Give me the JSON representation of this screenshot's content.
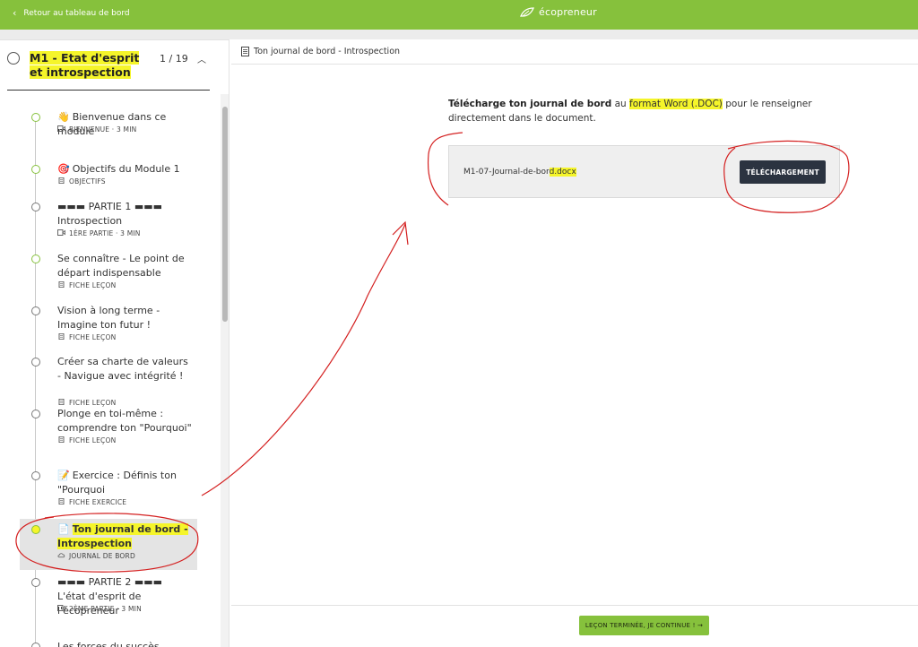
{
  "header": {
    "back_label": "Retour au tableau de bord",
    "logo_text": "écopreneur",
    "brand_color": "#86c13c"
  },
  "module": {
    "title": "M1 - Etat d'esprit et introspection",
    "progress": "1 / 19"
  },
  "lessons": [
    {
      "emoji": "👋",
      "title": "Bienvenue dans ce module",
      "meta": "BIENVENUE · 3 MIN",
      "meta_icon": "video-icon",
      "status": "done"
    },
    {
      "emoji": "🎯",
      "title": "Objectifs du Module 1",
      "meta": "OBJECTIFS",
      "meta_icon": "document-icon",
      "status": "done"
    },
    {
      "emoji": "",
      "title": "▬▬▬ PARTIE 1 ▬▬▬ Introspection",
      "meta": "1ÈRE PARTIE · 3 MIN",
      "meta_icon": "video-icon",
      "status": "todo"
    },
    {
      "emoji": "",
      "title": "Se connaître - Le point de départ indispensable",
      "meta": "FICHE LEÇON",
      "meta_icon": "document-icon",
      "status": "done"
    },
    {
      "emoji": "",
      "title": "Vision à long terme - Imagine ton futur !",
      "meta": "FICHE LEÇON",
      "meta_icon": "document-icon",
      "status": "todo"
    },
    {
      "emoji": "",
      "title": "Créer sa charte de valeurs - Navigue avec intégrité !",
      "meta": "FICHE LEÇON",
      "meta_icon": "document-icon",
      "status": "todo"
    },
    {
      "emoji": "",
      "title": "Plonge en toi-même : comprendre ton \"Pourquoi\"",
      "meta": "FICHE LEÇON",
      "meta_icon": "document-icon",
      "status": "todo"
    },
    {
      "emoji": "📝",
      "title": "Exercice : Définis ton \"Pourquoi",
      "meta": "FICHE EXERCICE",
      "meta_icon": "document-icon",
      "status": "todo"
    },
    {
      "emoji": "📄",
      "title": "Ton journal de bord - Introspection",
      "meta": "JOURNAL DE BORD",
      "meta_icon": "cloud-icon",
      "status": "active"
    },
    {
      "emoji": "",
      "title": "▬▬▬ PARTIE 2 ▬▬▬ L'état d'esprit de l'écopreneur",
      "meta": "2ÈME PARTIE · 3 MIN",
      "meta_icon": "video-icon",
      "status": "todo"
    },
    {
      "emoji": "",
      "title": "Les forces du succès",
      "meta": "",
      "meta_icon": "",
      "status": "todo"
    }
  ],
  "content": {
    "lesson_title": "Ton journal de bord - Introspection",
    "intro_bold": "Télécharge ton journal de bord",
    "intro_mid": " au ",
    "intro_highlight": "format Word (.DOC)",
    "intro_rest": " pour le renseigner directement dans le document.",
    "file_name_main": "M1-07-Journal-de-bor",
    "file_name_hl": "d.docx",
    "download_label": "TÉLÉCHARGEMENT"
  },
  "footer": {
    "continue_label": "LEÇON TERMINÉE, JE CONTINUE ! →"
  }
}
